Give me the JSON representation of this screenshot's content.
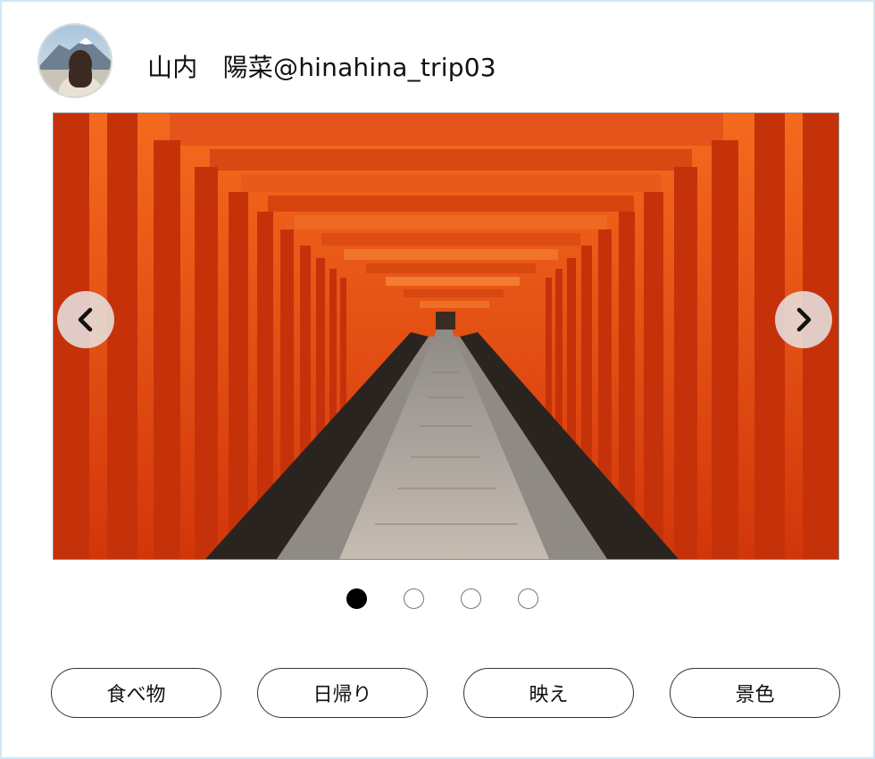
{
  "profile": {
    "display_name": "山内　陽菜@hinahina_trip03"
  },
  "carousel": {
    "image_subject": "torii-gate-tunnel",
    "total_slides": 4,
    "active_slide": 1,
    "prev_icon": "chevron-left-icon",
    "next_icon": "chevron-right-icon"
  },
  "tags": [
    {
      "label": "食べ物"
    },
    {
      "label": "日帰り"
    },
    {
      "label": "映え"
    },
    {
      "label": "景色"
    }
  ],
  "colors": {
    "frame_border": "#cfe8f5",
    "torii_orange": "#e84a0e",
    "dot_active": "#000000",
    "tag_border": "#333333"
  }
}
